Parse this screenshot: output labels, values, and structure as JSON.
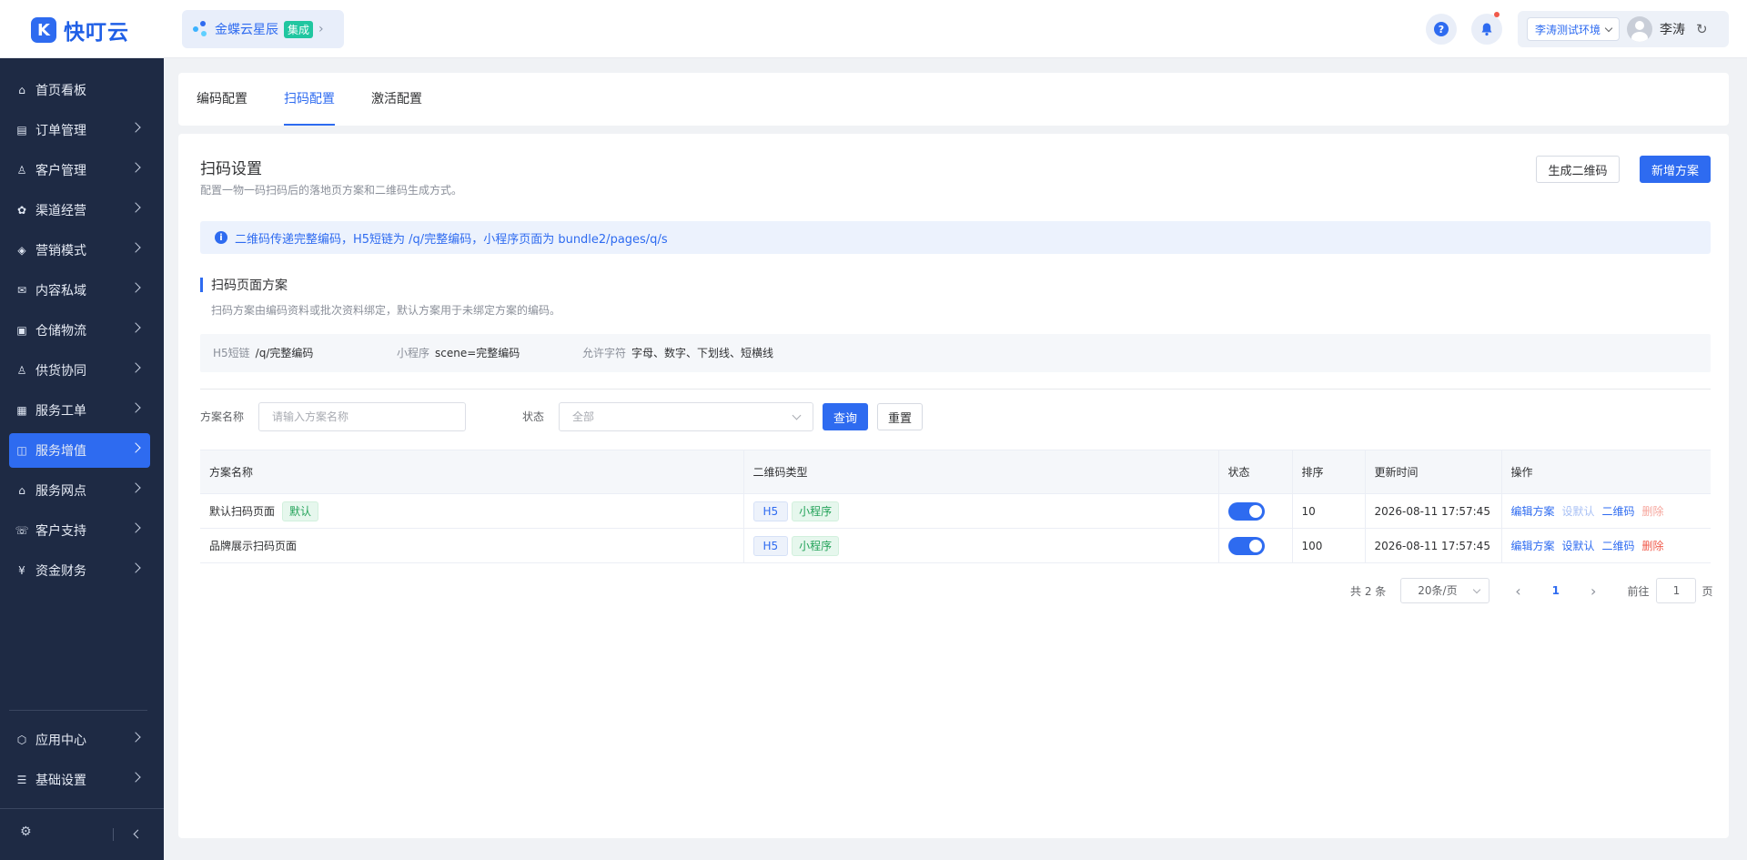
{
  "brand": {
    "logo_text": "快叮云",
    "logo_glyph": "K"
  },
  "app_chip": {
    "label": "金蝶云星辰",
    "badge": "集成"
  },
  "header": {
    "env_label": "李涛测试环境",
    "user_name": "李涛"
  },
  "sidebar": {
    "items": [
      {
        "label": "首页看板",
        "icon": "⌂"
      },
      {
        "label": "订单管理",
        "icon": "▤"
      },
      {
        "label": "客户管理",
        "icon": "♙"
      },
      {
        "label": "渠道经营",
        "icon": "✿"
      },
      {
        "label": "营销模式",
        "icon": "◈"
      },
      {
        "label": "内容私域",
        "icon": "✉"
      },
      {
        "label": "仓储物流",
        "icon": "▣"
      },
      {
        "label": "供货协同",
        "icon": "♙"
      },
      {
        "label": "服务工单",
        "icon": "▦"
      },
      {
        "label": "服务增值",
        "icon": "◫"
      },
      {
        "label": "服务网点",
        "icon": "⌂"
      },
      {
        "label": "客户支持",
        "icon": "☏"
      },
      {
        "label": "资金财务",
        "icon": "¥"
      }
    ],
    "bottom_items": [
      {
        "label": "应用中心",
        "icon": "⬡"
      },
      {
        "label": "基础设置",
        "icon": "☰"
      }
    ]
  },
  "tabs": [
    {
      "label": "编码配置"
    },
    {
      "label": "扫码配置"
    },
    {
      "label": "激活配置"
    }
  ],
  "page": {
    "title": "扫码设置",
    "subtitle": "配置一物一码扫码后的落地页方案和二维码生成方式。",
    "btn_generate": "生成二维码",
    "btn_add": "新增方案",
    "info_text": "二维码传递完整编码，H5短链为 /q/完整编码，小程序页面为 bundle2/pages/q/s",
    "section_title": "扫码页面方案",
    "section_desc": "扫码方案由编码资料或批次资料绑定，默认方案用于未绑定方案的编码。",
    "kv": [
      {
        "key": "H5短链",
        "value": "/q/完整编码"
      },
      {
        "key": "小程序",
        "value": "scene=完整编码"
      },
      {
        "key": "允许字符",
        "value": "字母、数字、下划线、短横线"
      }
    ]
  },
  "filters": {
    "name_label": "方案名称",
    "name_placeholder": "请输入方案名称",
    "status_label": "状态",
    "status_value": "全部",
    "query_btn": "查询",
    "reset_btn": "重置"
  },
  "table": {
    "headers": [
      "方案名称",
      "二维码类型",
      "状态",
      "排序",
      "更新时间",
      "操作"
    ],
    "rows": [
      {
        "name": "默认扫码页面",
        "default_tag": "默认",
        "type_h5": "H5",
        "type_mp": "小程序",
        "enabled": true,
        "sort": "10",
        "updated": "2026-08-11 17:57:45",
        "ops": [
          "编辑方案",
          "设默认",
          "二维码",
          "删除"
        ]
      },
      {
        "name": "品牌展示扫码页面",
        "default_tag": "",
        "type_h5": "H5",
        "type_mp": "小程序",
        "enabled": true,
        "sort": "100",
        "updated": "2026-08-11 17:57:45",
        "ops": [
          "编辑方案",
          "设默认",
          "二维码",
          "删除"
        ]
      }
    ]
  },
  "pagination": {
    "total": "共 2 条",
    "page_size": "20条/页",
    "current": "1",
    "goto_prefix": "前往",
    "goto_value": "1",
    "goto_suffix": "页"
  },
  "colors": {
    "primary": "#2e6bf0",
    "sidebar": "#1e2a44",
    "success": "#24a35a",
    "danger": "#f05a4b"
  }
}
